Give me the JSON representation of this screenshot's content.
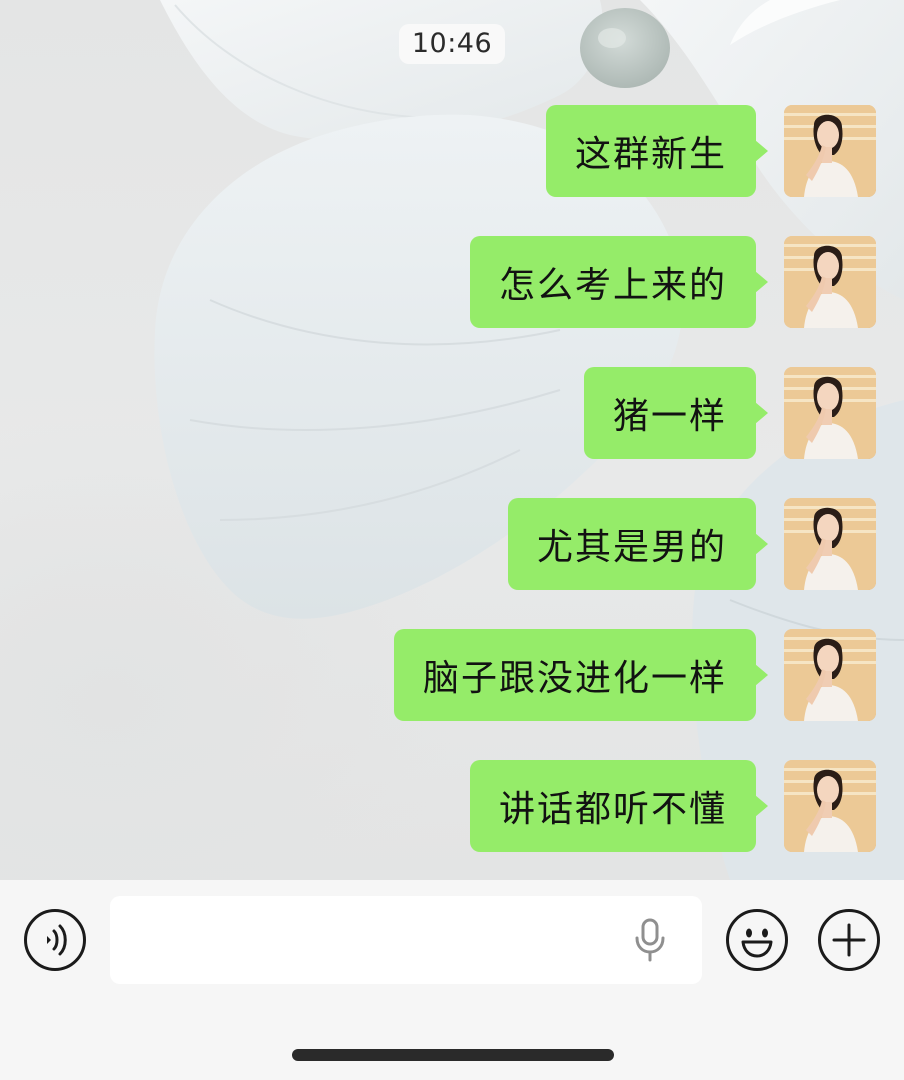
{
  "chat": {
    "timestamp": "10:46",
    "messages": [
      {
        "text": "这群新生",
        "sender": "self"
      },
      {
        "text": "怎么考上来的",
        "sender": "self"
      },
      {
        "text": "猪一样",
        "sender": "self"
      },
      {
        "text": "尤其是男的",
        "sender": "self"
      },
      {
        "text": "脑子跟没进化一样",
        "sender": "self"
      },
      {
        "text": "讲话都听不懂",
        "sender": "self"
      }
    ]
  },
  "input_bar": {
    "voice_icon": "voice-mode-icon",
    "text_value": "",
    "mic_icon": "microphone-icon",
    "emoji_icon": "emoji-icon",
    "plus_icon": "plus-icon"
  },
  "colors": {
    "bubble": "#95ec69",
    "input_bar_bg": "#f6f6f6",
    "wallpaper": "#e8e9e9"
  }
}
